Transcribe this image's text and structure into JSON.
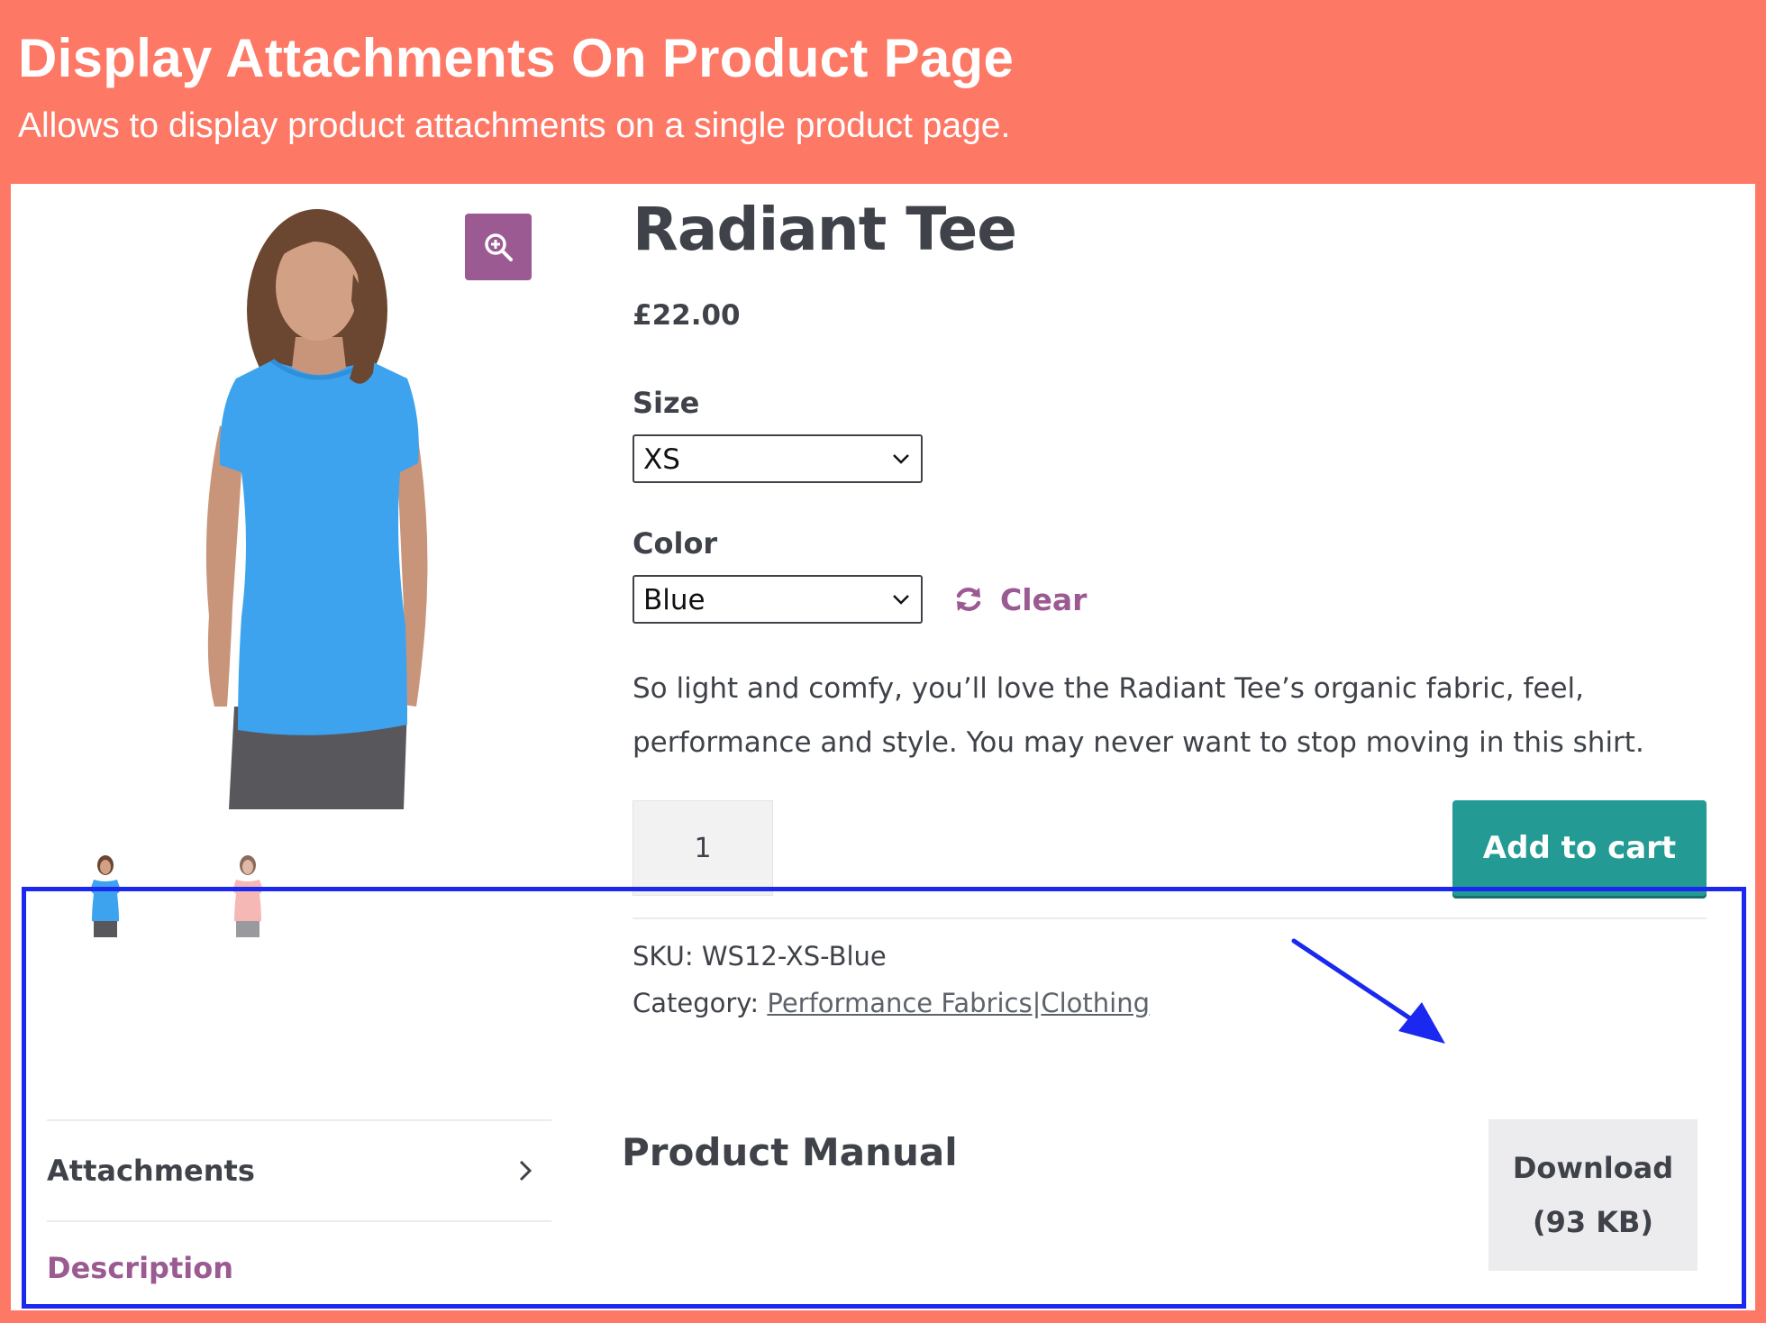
{
  "banner": {
    "title": "Display Attachments On Product Page",
    "subtitle": "Allows to display product attachments on a single product page."
  },
  "product": {
    "title": "Radiant Tee",
    "price": "£22.00",
    "size_label": "Size",
    "size_value": "XS",
    "color_label": "Color",
    "color_value": "Blue",
    "clear_label": "Clear",
    "description": "So light and comfy, you’ll love the Radiant Tee’s organic fabric, feel, performance and style. You may never want to stop moving in this shirt.",
    "quantity": "1",
    "add_to_cart_label": "Add to cart",
    "sku_label": "SKU:",
    "sku_value": "WS12-XS-Blue",
    "category_label": "Category:",
    "categories": [
      "Performance Fabrics",
      "Clothing"
    ],
    "category_separator": "|"
  },
  "gallery": {
    "icons": {
      "zoom": "zoom-in-icon"
    },
    "colors": {
      "zoom_bg": "#9b5a92",
      "shirt_blue": "#3ea3ee",
      "shirt_pink": "#f6b8b4"
    }
  },
  "tabs": {
    "attachments_label": "Attachments",
    "description_label": "Description"
  },
  "attachment": {
    "title": "Product Manual",
    "download_label": "Download",
    "download_size": "(93 KB)"
  },
  "colors": {
    "banner": "#fe7866",
    "accent_purple": "#9b5a92",
    "cart_button": "#239b94",
    "highlight_box": "#1a28f0",
    "text": "#3f4349"
  }
}
